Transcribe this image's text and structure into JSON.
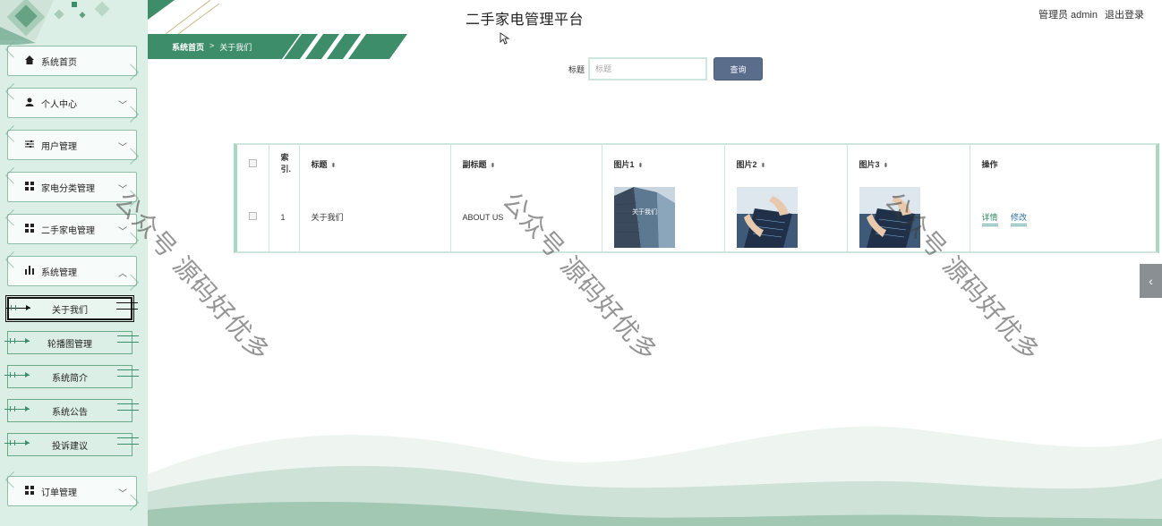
{
  "app": {
    "title": "二手家电管理平台",
    "user_label": "管理员 admin",
    "logout_label": "退出登录"
  },
  "sidebar": {
    "items": [
      {
        "label": "系统首页",
        "icon": "home-icon",
        "expandable": false
      },
      {
        "label": "个人中心",
        "icon": "user-icon",
        "expandable": true
      },
      {
        "label": "用户管理",
        "icon": "sliders-icon",
        "expandable": true
      },
      {
        "label": "家电分类管理",
        "icon": "grid-icon",
        "expandable": true
      },
      {
        "label": "二手家电管理",
        "icon": "grid-icon",
        "expandable": true
      },
      {
        "label": "系统管理",
        "icon": "bar-chart-icon",
        "expandable": true,
        "expanded": true
      },
      {
        "label": "订单管理",
        "icon": "grid-icon",
        "expandable": true
      }
    ],
    "sub_items": [
      {
        "label": "关于我们",
        "active": true
      },
      {
        "label": "轮播图管理",
        "active": false
      },
      {
        "label": "系统简介",
        "active": false
      },
      {
        "label": "系统公告",
        "active": false
      },
      {
        "label": "投诉建议",
        "active": false
      }
    ]
  },
  "breadcrumb": {
    "home": "系统首页",
    "separator": ">",
    "current": "关于我们"
  },
  "search": {
    "label": "标题",
    "placeholder": "标题",
    "value": "",
    "button_label": "查询"
  },
  "table": {
    "headers": [
      "索引.",
      "标题",
      "副标题",
      "图片1",
      "图片2",
      "图片3",
      "操作"
    ],
    "sortable": [
      false,
      true,
      true,
      true,
      true,
      true,
      false
    ],
    "rows": [
      {
        "index": "1",
        "title": "关于我们",
        "subtitle": "ABOUT US",
        "image1": "office-building-image",
        "image2": "business-tablet-image",
        "image3": "business-tablet-image",
        "image1_caption": "关于我们",
        "actions": {
          "detail": "详情",
          "edit": "修改"
        }
      }
    ]
  },
  "watermark": "公众号 源码好优多",
  "colors": {
    "sidebar_bg": "#dcefe6",
    "accent_green": "#3d8c6a",
    "button_blue": "#5a6e8c",
    "border": "#cfe6dc"
  }
}
